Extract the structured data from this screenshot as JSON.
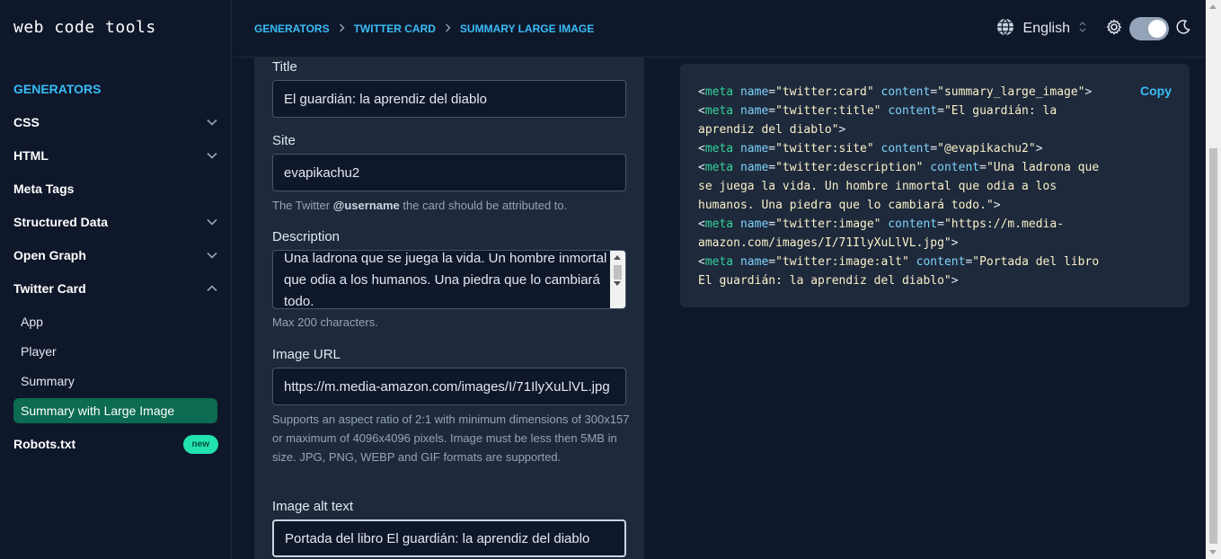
{
  "app": {
    "logo": "web code tools"
  },
  "sidebar": {
    "section_title": "GENERATORS",
    "items": [
      {
        "label": "CSS"
      },
      {
        "label": "HTML"
      },
      {
        "label": "Meta Tags"
      },
      {
        "label": "Structured Data"
      },
      {
        "label": "Open Graph"
      },
      {
        "label": "Twitter Card"
      }
    ],
    "sub_items": [
      {
        "label": "App"
      },
      {
        "label": "Player"
      },
      {
        "label": "Summary"
      },
      {
        "label": "Summary with Large Image"
      }
    ],
    "robots": {
      "label": "Robots.txt",
      "badge": "new"
    }
  },
  "header": {
    "breadcrumbs": [
      "GENERATORS",
      "TWITTER CARD",
      "SUMMARY LARGE IMAGE"
    ],
    "language": "English"
  },
  "form": {
    "title": {
      "label": "Title",
      "value": "El guardián: la aprendiz del diablo"
    },
    "site": {
      "label": "Site",
      "value": "evapikachu2",
      "hint_pre": "The Twitter ",
      "hint_bold": "@username",
      "hint_post": " the card should be attributed to."
    },
    "description": {
      "label": "Description",
      "value": "Una ladrona que se juega la vida. Un hombre inmortal que odia a los humanos. Una piedra que lo cambiará todo.",
      "hint": "Max 200 characters."
    },
    "image_url": {
      "label": "Image URL",
      "value": "https://m.media-amazon.com/images/I/71IlyXuLlVL.jpg",
      "hint": "Supports an aspect ratio of 2:1 with minimum dimensions of 300x157 or maximum of 4096x4096 pixels. Image must be less then 5MB in size. JPG, PNG, WEBP and GIF formats are supported."
    },
    "image_alt": {
      "label": "Image alt text",
      "value": "Portada del libro El guardián: la aprendiz del diablo"
    }
  },
  "output": {
    "copy_label": "Copy",
    "lines": [
      {
        "name": "twitter:card",
        "content": "summary_large_image"
      },
      {
        "name": "twitter:title",
        "content": "El guardián: la\naprendiz del diablo"
      },
      {
        "name": "twitter:site",
        "content": "@evapikachu2"
      },
      {
        "name": "twitter:description",
        "content": "Una ladrona que\nse juega la vida. Un hombre inmortal que odia a los\nhumanos. Una piedra que lo cambiará todo."
      },
      {
        "name": "twitter:image",
        "content": "https://m.media-\namazon.com/images/I/71IlyXuLlVL.jpg"
      },
      {
        "name": "twitter:image:alt",
        "content": "Portada del libro\nEl guardián: la aprendiz del diablo"
      }
    ]
  },
  "icons": {
    "globe": "globe-icon",
    "gear": "gear-icon",
    "moon": "moon-icon",
    "chevron": "chevron-down-icon"
  },
  "colors": {
    "accent": "#38bdf8",
    "active_bg": "#0c6b50",
    "badge_bg": "#22e3b0",
    "panel_bg": "#1e293b",
    "page_bg": "#0f172a"
  }
}
